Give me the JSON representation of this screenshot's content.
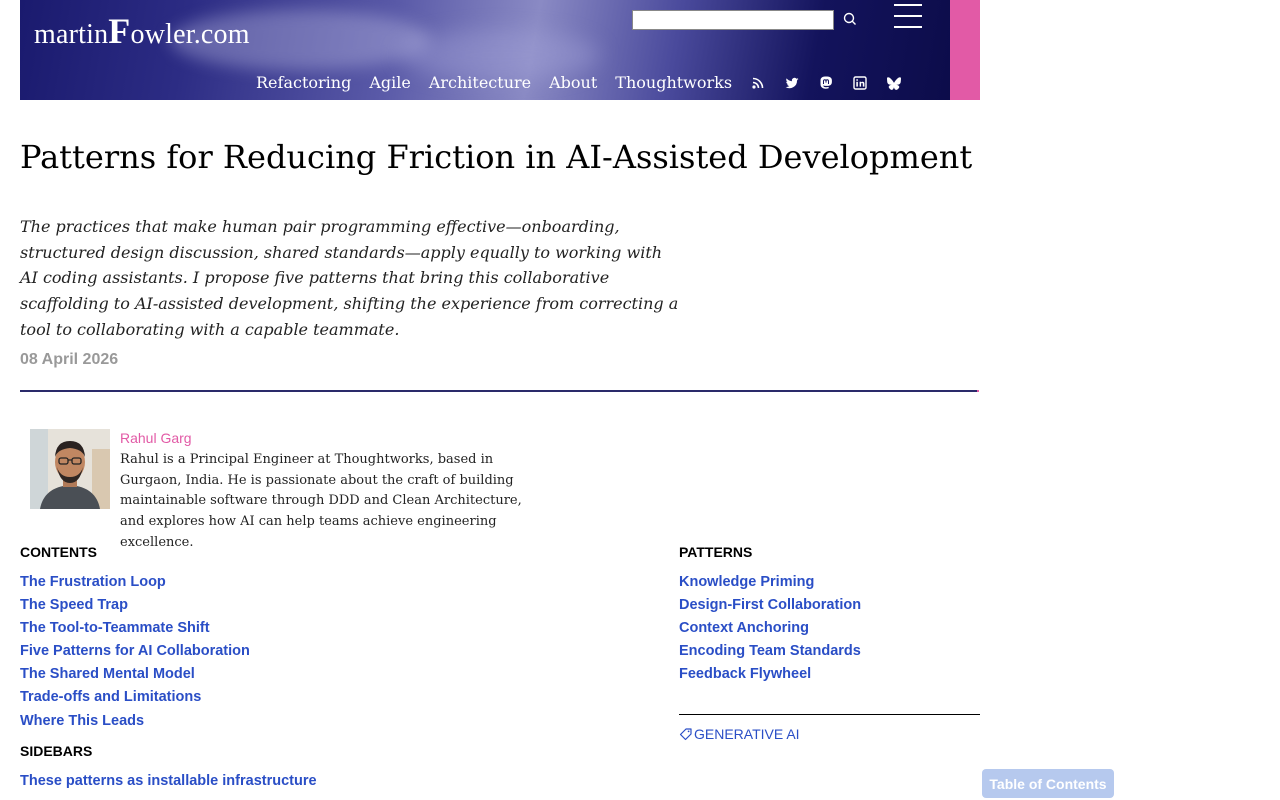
{
  "header": {
    "logo_prefix": "martin",
    "logo_initial": "F",
    "logo_suffix": "owler.com",
    "search_value": "",
    "nav": [
      "Refactoring",
      "Agile",
      "Architecture",
      "About",
      "Thoughtworks"
    ],
    "social_icons": [
      "rss-icon",
      "twitter-icon",
      "mastodon-icon",
      "linkedin-icon",
      "bluesky-icon"
    ],
    "colors": {
      "banner": "#1a1a6e",
      "accent": "#e25aa6"
    }
  },
  "article": {
    "title": "Patterns for Reducing Friction in AI-Assisted Development",
    "abstract": "The practices that make human pair programming effective—onboarding, structured design discussion, shared standards—apply equally to working with AI coding assistants. I propose five patterns that bring this collaborative scaffolding to AI-assisted development, shifting the experience from correcting a tool to collaborating with a capable teammate.",
    "date": "08 April 2026"
  },
  "author": {
    "name": "Rahul Garg",
    "bio": "Rahul is a Principal Engineer at Thoughtworks, based in Gurgaon, India. He is passionate about the craft of building maintainable software through DDD and Clean Architecture, and explores how AI can help teams achieve engineering excellence."
  },
  "contents": {
    "heading": "CONTENTS",
    "items": [
      "The Frustration Loop",
      "The Speed Trap",
      "The Tool-to-Teammate Shift",
      "Five Patterns for AI Collaboration",
      "The Shared Mental Model",
      "Trade-offs and Limitations",
      "Where This Leads"
    ]
  },
  "sidebars": {
    "heading": "SIDEBARS",
    "items": [
      "These patterns as installable infrastructure"
    ]
  },
  "patterns": {
    "heading": "PATTERNS",
    "items": [
      "Knowledge Priming",
      "Design-First Collaboration",
      "Context Anchoring",
      "Encoding Team Standards",
      "Feedback Flywheel"
    ]
  },
  "tag": {
    "label": "GENERATIVE AI",
    "icon": "tag-icon"
  },
  "toc_button": {
    "label": "Table of Contents"
  },
  "colors": {
    "link": "#2a4ec6",
    "author": "#e25aa6",
    "toc_bg": "#b6c9ee"
  }
}
